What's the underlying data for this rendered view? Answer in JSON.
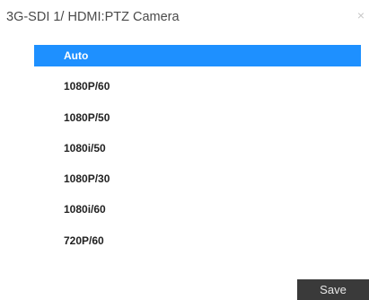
{
  "dialog": {
    "title": "3G-SDI 1/ HDMI:PTZ Camera",
    "close_glyph": "×"
  },
  "options": [
    {
      "label": "Auto",
      "selected": true
    },
    {
      "label": "1080P/60",
      "selected": false
    },
    {
      "label": "1080P/50",
      "selected": false
    },
    {
      "label": "1080i/50",
      "selected": false
    },
    {
      "label": "1080P/30",
      "selected": false
    },
    {
      "label": "1080i/60",
      "selected": false
    },
    {
      "label": "720P/60",
      "selected": false
    }
  ],
  "footer": {
    "save_label": "Save"
  },
  "colors": {
    "selected_bg": "#1e90ff",
    "save_bg": "#3a3a3a"
  }
}
